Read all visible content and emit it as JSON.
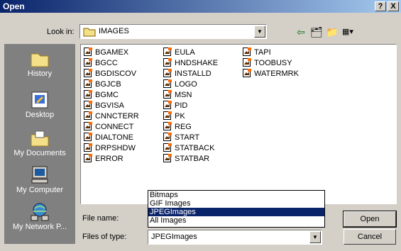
{
  "window": {
    "title": "Open",
    "help_glyph": "?",
    "close_glyph": "X"
  },
  "lookin": {
    "label": "Look in:",
    "value": "IMAGES"
  },
  "toolbar": [
    {
      "name": "back-icon",
      "glyph": "⇦"
    },
    {
      "name": "up-folder-icon",
      "glyph": "🗂"
    },
    {
      "name": "new-folder-icon",
      "glyph": "📁"
    },
    {
      "name": "view-menu-icon",
      "glyph": "▦▾"
    }
  ],
  "places": [
    {
      "label": "History",
      "icon": "history-icon"
    },
    {
      "label": "Desktop",
      "icon": "desktop-icon"
    },
    {
      "label": "My Documents",
      "icon": "my-documents-icon"
    },
    {
      "label": "My Computer",
      "icon": "my-computer-icon"
    },
    {
      "label": "My Network P...",
      "icon": "my-network-icon"
    }
  ],
  "files": {
    "col1": [
      "BGAMEX",
      "BGCC",
      "BGDISCOV",
      "BGJCB",
      "BGMC",
      "BGVISA",
      "CNNCTERR",
      "CONNECT",
      "DIALTONE",
      "DRPSHDW",
      "ERROR"
    ],
    "col2": [
      "EULA",
      "HNDSHAKE",
      "INSTALLD",
      "LOGO",
      "MSN",
      "PID",
      "PK",
      "REG",
      "START",
      "STATBACK",
      "STATBAR"
    ],
    "col3": [
      "TAPI",
      "TOOBUSY",
      "WATERMRK"
    ]
  },
  "filename": {
    "label": "File name:",
    "value": ""
  },
  "filetype": {
    "label": "Files of type:",
    "value": "JPEGImages",
    "options": [
      "Bitmaps",
      "GIF Images",
      "JPEGImages",
      "All Images"
    ],
    "selected_index": 2
  },
  "buttons": {
    "open": "Open",
    "cancel": "Cancel"
  },
  "colors": {
    "title_start": "#0a246a",
    "title_end": "#a6caf0",
    "face": "#d4d0c8",
    "places_bg": "#808080"
  }
}
